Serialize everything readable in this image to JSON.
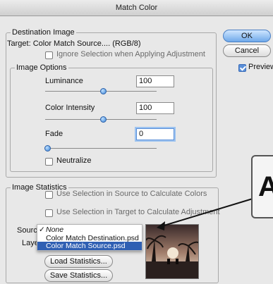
{
  "window": {
    "title": "Match Color"
  },
  "destination": {
    "legend": "Destination Image",
    "target_label": "Target:",
    "target_value": "Color Match Source.... (RGB/8)",
    "ignore_selection_label": "Ignore Selection when Applying Adjustment",
    "ignore_selection_checked": false
  },
  "image_options": {
    "legend": "Image Options",
    "luminance": {
      "label": "Luminance",
      "value": "100",
      "slider_level": 0.5
    },
    "color_intensity": {
      "label": "Color Intensity",
      "value": "100",
      "slider_level": 0.5
    },
    "fade": {
      "label": "Fade",
      "value": "0",
      "slider_level": 0.0
    },
    "neutralize": {
      "label": "Neutralize",
      "checked": false
    }
  },
  "buttons": {
    "ok": "OK",
    "cancel": "Cancel"
  },
  "preview": {
    "label": "Preview",
    "checked": true
  },
  "image_statistics": {
    "legend": "Image Statistics",
    "use_selection_source": {
      "label": "Use Selection in Source to Calculate Colors",
      "checked": false
    },
    "use_selection_target": {
      "label": "Use Selection in Target to Calculate Adjustment",
      "checked": false
    },
    "source_label": "Sourc",
    "layer_label": "Laye",
    "load_button": "Load Statistics...",
    "save_button": "Save Statistics..."
  },
  "source_menu": {
    "items": [
      {
        "label": "None",
        "checked": true,
        "italic": true
      },
      {
        "label": "Color Match Destination.psd",
        "checked": false
      },
      {
        "label": "Color Match Source.psd",
        "checked": false,
        "highlighted": true
      }
    ],
    "check_mark": "✓"
  },
  "callout": {
    "letter": "A"
  },
  "colors": {
    "accent_blue": "#2f5fb3",
    "slider_thumb": "#3a84d6",
    "dialog_bg": "#e8e8e8"
  }
}
